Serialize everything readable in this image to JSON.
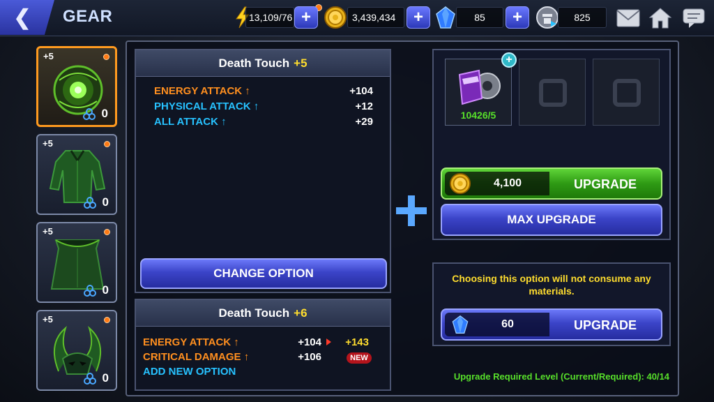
{
  "header": {
    "title": "GEAR",
    "energy": "13,109/76",
    "gold": "3,439,434",
    "crystals": "85",
    "tokens": "825"
  },
  "gear_slots": [
    {
      "level": "+5",
      "count": "0",
      "name": "death-touch-orb"
    },
    {
      "level": "+5",
      "count": "0",
      "name": "green-suit"
    },
    {
      "level": "+5",
      "count": "0",
      "name": "green-cape"
    },
    {
      "level": "+5",
      "count": "0",
      "name": "horned-helmet"
    }
  ],
  "current_option": {
    "name": "Death Touch",
    "level": "+5",
    "stats": [
      {
        "name": "ENERGY ATTACK ↑",
        "value": "+104",
        "color": "#ff8f1f"
      },
      {
        "name": "PHYSICAL ATTACK ↑",
        "value": "+12",
        "color": "#27c2ff"
      },
      {
        "name": "ALL ATTACK ↑",
        "value": "+29",
        "color": "#27c2ff"
      }
    ],
    "change_button": "CHANGE OPTION"
  },
  "next_option": {
    "name": "Death Touch",
    "level": "+6",
    "stats": [
      {
        "name": "ENERGY ATTACK ↑",
        "value": "+104",
        "new_value": "+143"
      },
      {
        "name": "CRITICAL DAMAGE ↑",
        "value": "+106",
        "badge": "NEW"
      }
    ],
    "add_option": "ADD NEW OPTION"
  },
  "materials": {
    "count": "10426/5"
  },
  "upgrade": {
    "gold_cost": "4,100",
    "label": "UPGRADE",
    "max_label": "MAX UPGRADE"
  },
  "crystal_upgrade": {
    "note": "Choosing this option will not consume any materials.",
    "cost": "60",
    "label": "UPGRADE"
  },
  "footer": {
    "required_level": "Upgrade Required Level (Current/Required): 40/14"
  },
  "colors": {
    "accent_orange": "#ff8f1f",
    "accent_blue": "#27c2ff",
    "accent_yellow": "#ffdd2e",
    "accent_green": "#57e02a",
    "button_blue": "#3b44c8"
  }
}
